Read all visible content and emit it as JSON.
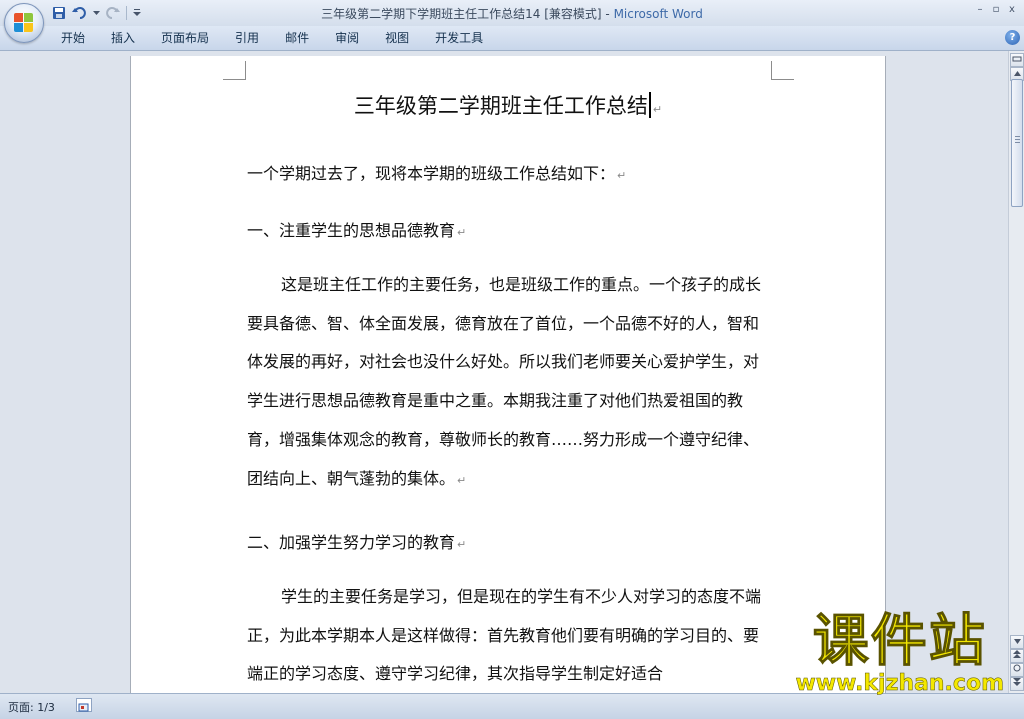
{
  "window": {
    "title": "三年级第二学期下学期班主任工作总结14 [兼容模式] - ",
    "app_name": "Microsoft Word",
    "controls": [
      "–",
      "▫",
      "x"
    ]
  },
  "ribbon": {
    "tabs": [
      "开始",
      "插入",
      "页面布局",
      "引用",
      "邮件",
      "审阅",
      "视图",
      "开发工具"
    ],
    "help": "?"
  },
  "document": {
    "title": "三年级第二学期班主任工作总结",
    "intro": "一个学期过去了，现将本学期的班级工作总结如下：",
    "heading1": "一、注重学生的思想品德教育",
    "para1": "这是班主任工作的主要任务，也是班级工作的重点。一个孩子的成长要具备德、智、体全面发展，德育放在了首位，一个品德不好的人，智和体发展的再好，对社会也没什么好处。所以我们老师要关心爱护学生，对学生进行思想品德教育是重中之重。本期我注重了对他们热爱祖国的教育，增强集体观念的教育，尊敬师长的教育……努力形成一个遵守纪律、团结向上、朝气蓬勃的集体。",
    "heading2": "二、加强学生努力学习的教育",
    "para2": "学生的主要任务是学习，但是现在的学生有不少人对学习的态度不端正，为此本学期本人是这样做得：首先教育他们要有明确的学习目的、要端正的学习态度、遵守学习纪律，其次指导学生制定好适合",
    "paragraph_mark": "↵"
  },
  "status": {
    "page": "页面: 1/3"
  },
  "watermark": {
    "cn": "课件站",
    "url": "www.kjzhan.com"
  }
}
